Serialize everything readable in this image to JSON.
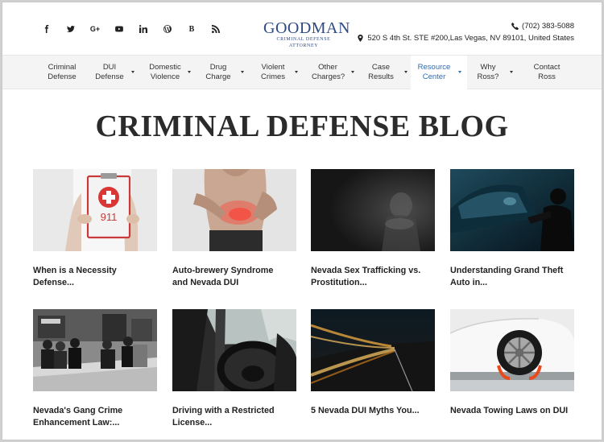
{
  "header": {
    "social_icons": [
      "facebook-icon",
      "twitter-icon",
      "google-plus-icon",
      "youtube-icon",
      "linkedin-icon",
      "wordpress-icon",
      "blogger-icon",
      "rss-icon"
    ],
    "logo": {
      "name": "GOODMAN",
      "tagline": "CRIMINAL DEFENSE ATTORNEY",
      "color": "#2e4a82"
    },
    "phone": "(702) 383-5088",
    "address": "520 S 4th St. STE #200,Las Vegas, NV 89101, United States"
  },
  "nav": {
    "items": [
      {
        "line1": "Criminal",
        "line2": "Defense",
        "dropdown": false,
        "active": false
      },
      {
        "line1": "DUI",
        "line2": "Defense",
        "dropdown": true,
        "active": false
      },
      {
        "line1": "Domestic",
        "line2": "Violence",
        "dropdown": true,
        "active": false
      },
      {
        "line1": "Drug",
        "line2": "Charge",
        "dropdown": true,
        "active": false
      },
      {
        "line1": "Violent",
        "line2": "Crimes",
        "dropdown": true,
        "active": false
      },
      {
        "line1": "Other",
        "line2": "Charges?",
        "dropdown": true,
        "active": false
      },
      {
        "line1": "Case",
        "line2": "Results",
        "dropdown": true,
        "active": false
      },
      {
        "line1": "Resource",
        "line2": "Center",
        "dropdown": true,
        "active": true
      },
      {
        "line1": "Why",
        "line2": "Ross?",
        "dropdown": true,
        "active": false
      },
      {
        "line1": "Contact",
        "line2": "Ross",
        "dropdown": false,
        "active": false
      }
    ],
    "active_color": "#2e6db4"
  },
  "page": {
    "title": "CRIMINAL DEFENSE BLOG"
  },
  "posts": [
    {
      "line1": "When is a Necessity",
      "line2": "Defense...",
      "image": "911-clipboard-image",
      "badge": "911"
    },
    {
      "line1": "Auto-brewery Syndrome",
      "line2": "and Nevada DUI",
      "image": "stomach-pain-image"
    },
    {
      "line1": "Nevada Sex Trafficking vs.",
      "line2": "Prostitution...",
      "image": "dark-figure-image"
    },
    {
      "line1": "Understanding Grand Theft",
      "line2": "Auto in...",
      "image": "car-thief-image"
    },
    {
      "line1": "Nevada's Gang Crime",
      "line2": "Enhancement Law:...",
      "image": "street-group-image"
    },
    {
      "line1": "Driving with a Restricted",
      "line2": "License...",
      "image": "steering-wheel-image"
    },
    {
      "line1": "5 Nevada DUI Myths You...",
      "line2": "",
      "image": "night-road-image"
    },
    {
      "line1": "Nevada Towing Laws on DUI",
      "line2": "",
      "image": "towed-car-image"
    }
  ]
}
